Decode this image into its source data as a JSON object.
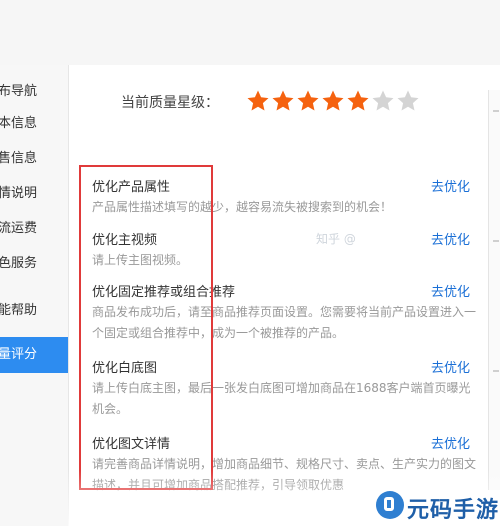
{
  "sidebar": {
    "items": [
      {
        "label": "布导航"
      },
      {
        "label": "本信息"
      },
      {
        "label": "售信息"
      },
      {
        "label": "情说明"
      },
      {
        "label": "流运费"
      },
      {
        "label": "色服务"
      },
      {
        "label": "能帮助"
      },
      {
        "label": "量评分"
      }
    ],
    "active_index": 7,
    "active_color": "#2d8cf0"
  },
  "quality": {
    "label": "当前质量星级：",
    "stars_filled": 5,
    "stars_total": 7,
    "filled_color": "#f5620f",
    "empty_color": "#d4d4d4"
  },
  "items": [
    {
      "title": "优化产品属性",
      "link": "去优化",
      "desc": "产品属性描述填写的越少，越容易流失被搜索到的机会！"
    },
    {
      "title": "优化主视频",
      "link": "去优化",
      "desc": "请上传主图视频。"
    },
    {
      "title": "优化固定推荐或组合推荐",
      "link": "去优化",
      "desc": "商品发布成功后，请至商品推荐页面设置。您需要将当前产品设置进入一个固定或组合推荐中，成为一个被推荐的产品。"
    },
    {
      "title": "优化白底图",
      "link": "去优化",
      "desc": "请上传白底主图，最后一张发白底图可增加商品在1688客户端首页曝光机会。"
    },
    {
      "title": "优化图文详情",
      "link": "去优化",
      "desc": "请完善商品详情说明，增加商品细节、规格尺寸、卖点、生产实力的图文描述，并且可增加商品搭配推荐，引导领取优惠"
    }
  ],
  "highlight_color": "#e03a3a",
  "link_color": "#1a6fd6",
  "watermark": "知乎 @",
  "site_logo": "元码手游网"
}
